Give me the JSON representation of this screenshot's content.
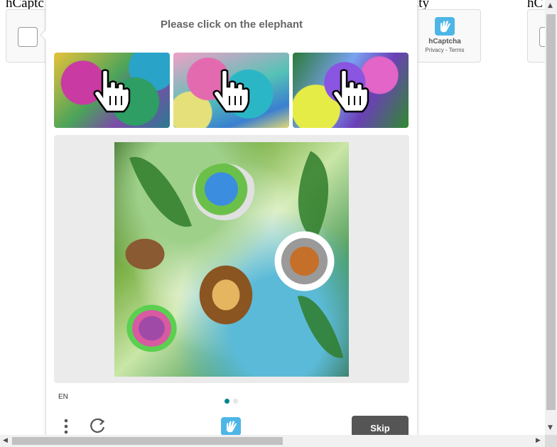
{
  "background": {
    "texts": [
      "hCaptc",
      "ity",
      "hC"
    ],
    "brand": {
      "name": "hCaptcha",
      "privacy": "Privacy",
      "separator": " - ",
      "terms": "Terms"
    }
  },
  "challenge": {
    "prompt": "Please click on the elephant",
    "language": "EN",
    "skip_label": "Skip",
    "pagination": {
      "current": 1,
      "total": 2
    }
  },
  "colors": {
    "accent": "#00838f",
    "skip_bg": "#555555",
    "prompt_text": "#666666",
    "task_bg": "#ebebeb",
    "logo_blue": "#4db6e6"
  },
  "icons": {
    "menu": "vertical-dots-icon",
    "refresh": "refresh-icon",
    "logo": "hcaptcha-hand-logo",
    "cursor": "hand-pointer-icon"
  }
}
